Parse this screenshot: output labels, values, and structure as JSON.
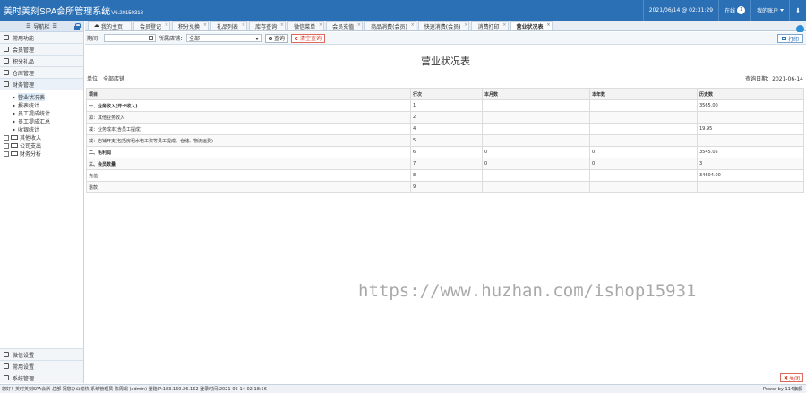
{
  "header": {
    "title": "美时美刻SPA会所管理系统",
    "version": "V6.20150318",
    "datetime": "2021/06/14 @ 02:31:29",
    "online_label": "在线",
    "online_count": "1",
    "account_label": "我的账户"
  },
  "sidebar": {
    "nav_label": "导航栏",
    "items": [
      "常用功能",
      "会员管理",
      "积分礼品",
      "仓库管理",
      "财务管理"
    ],
    "tree": {
      "children": [
        "营业状况表",
        "报表统计",
        "员工提成统计",
        "员工提成汇总",
        "收银统计"
      ],
      "folders": [
        "其他收入",
        "公司支出",
        "财务分析"
      ]
    },
    "bottom_items": [
      "微信设置",
      "常用设置",
      "系统管理"
    ]
  },
  "tabs": [
    "我的主页",
    "会员登记",
    "积分兑换",
    "礼品列表",
    "库存查询",
    "微信菜单",
    "会员充值",
    "商品消费(会员)",
    "快速消费(会员)",
    "消费打印",
    "营业状况表"
  ],
  "toolbar": {
    "period_label": "期间：",
    "store_label": "所属店铺：",
    "store_value": "全部",
    "search_label": "查询",
    "clear_label": "清空查询",
    "print_label": "打印"
  },
  "report": {
    "title": "营业状况表",
    "unit": "单位：全部店铺",
    "query_date": "查询日期：2021-06-14",
    "columns": [
      "项目",
      "行次",
      "本月数",
      "本年数",
      "历史数"
    ],
    "rows": [
      {
        "item": "一、业务收入(开卡收入)",
        "line": "1",
        "month": "",
        "year": "",
        "history": "3565.00",
        "bold": true
      },
      {
        "item": "加：其他业务收入",
        "line": "2",
        "month": "",
        "year": "",
        "history": "",
        "bold": false
      },
      {
        "item": "减：业务成本(含员工提成)",
        "line": "4",
        "month": "",
        "year": "",
        "history": "19.95",
        "bold": false
      },
      {
        "item": "减：店铺开支(包括房租水电工资等员工提成、仓储、物流运费)",
        "line": "5",
        "month": "",
        "year": "",
        "history": "",
        "bold": false
      },
      {
        "item": "二、毛利润",
        "line": "6",
        "month": "0",
        "year": "0",
        "history": "3545.05",
        "bold": true
      },
      {
        "item": "三、会员数量",
        "line": "7",
        "month": "0",
        "year": "0",
        "history": "3",
        "bold": true
      },
      {
        "item": "充值",
        "line": "8",
        "month": "",
        "year": "",
        "history": "34604.00",
        "bold": false
      },
      {
        "item": "退款",
        "line": "9",
        "month": "",
        "year": "",
        "history": "",
        "bold": false
      }
    ]
  },
  "watermark": "https://www.huzhan.com/ishop15931",
  "footer": {
    "close_label": "关闭",
    "status": "您好！美时美刻SPA会所-总部 祝您办公愉快 系统管理员 陈周娟 (admin) 登陆IP:183.160.26.162 登录时间:2021-06-14 02:18:56",
    "power": "Power by 114旗舰"
  }
}
